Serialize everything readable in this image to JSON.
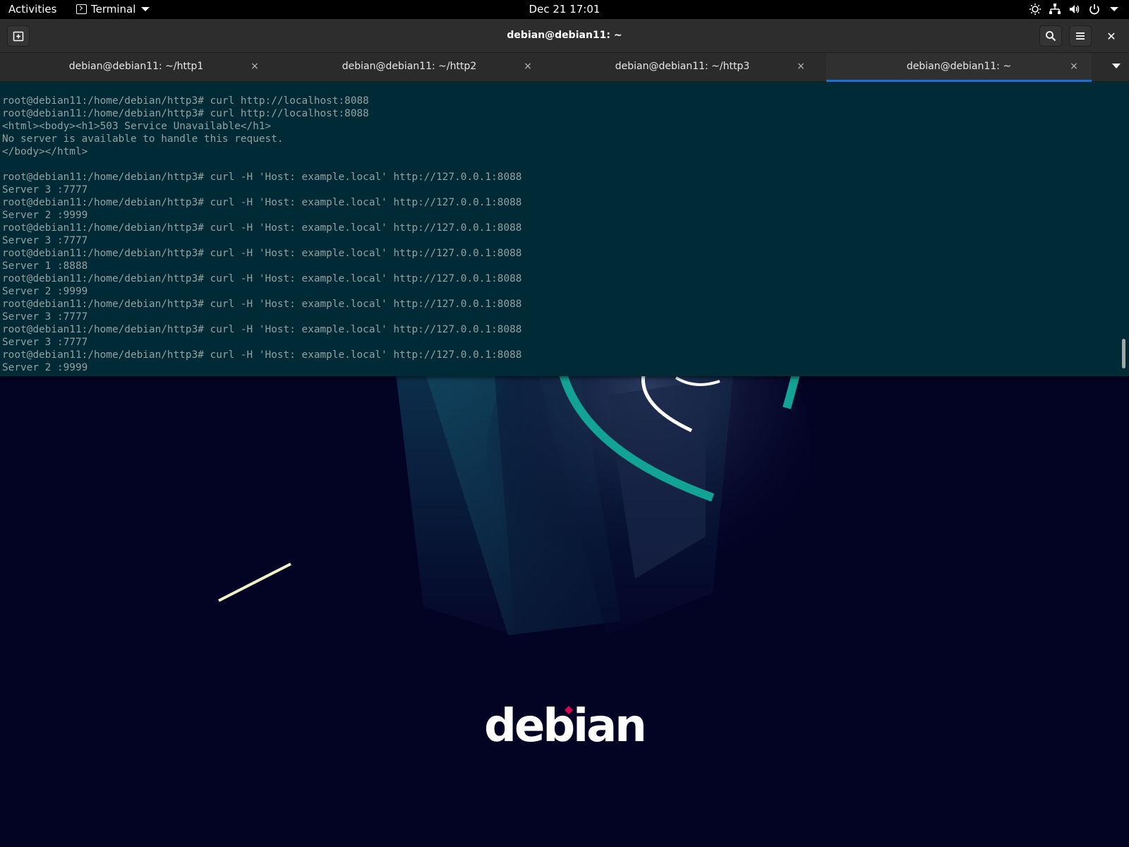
{
  "topbar": {
    "activities": "Activities",
    "app_name": "Terminal",
    "clock": "Dec 21  17:01",
    "status_icons": [
      "brightness-icon",
      "network-icon",
      "volume-icon",
      "power-icon",
      "chevron-down-icon"
    ]
  },
  "window": {
    "title": "debian@debian11: ~",
    "tabs": [
      {
        "label": "debian@debian11: ~/http1",
        "active": false
      },
      {
        "label": "debian@debian11: ~/http2",
        "active": false
      },
      {
        "label": "debian@debian11: ~/http3",
        "active": false
      },
      {
        "label": "debian@debian11: ~",
        "active": true
      }
    ],
    "tab_close_glyph": "×",
    "close_glyph": "✕"
  },
  "terminal": {
    "lines": [
      "root@debian11:/home/debian/http3# curl http://localhost:8088",
      "root@debian11:/home/debian/http3# curl http://localhost:8088",
      "<html><body><h1>503 Service Unavailable</h1>",
      "No server is available to handle this request.",
      "</body></html>",
      "",
      "root@debian11:/home/debian/http3# curl -H 'Host: example.local' http://127.0.0.1:8088",
      "Server 3 :7777",
      "root@debian11:/home/debian/http3# curl -H 'Host: example.local' http://127.0.0.1:8088",
      "Server 2 :9999",
      "root@debian11:/home/debian/http3# curl -H 'Host: example.local' http://127.0.0.1:8088",
      "Server 3 :7777",
      "root@debian11:/home/debian/http3# curl -H 'Host: example.local' http://127.0.0.1:8088",
      "Server 1 :8888",
      "root@debian11:/home/debian/http3# curl -H 'Host: example.local' http://127.0.0.1:8088",
      "Server 2 :9999",
      "root@debian11:/home/debian/http3# curl -H 'Host: example.local' http://127.0.0.1:8088",
      "Server 3 :7777",
      "root@debian11:/home/debian/http3# curl -H 'Host: example.local' http://127.0.0.1:8088",
      "Server 3 :7777",
      "root@debian11:/home/debian/http3# curl -H 'Host: example.local' http://127.0.0.1:8088",
      "Server 2 :9999"
    ],
    "background": "#002b36",
    "foreground": "#93a1a1"
  },
  "desktop": {
    "logo_text": "debian",
    "logo_accent": "#d70751"
  }
}
